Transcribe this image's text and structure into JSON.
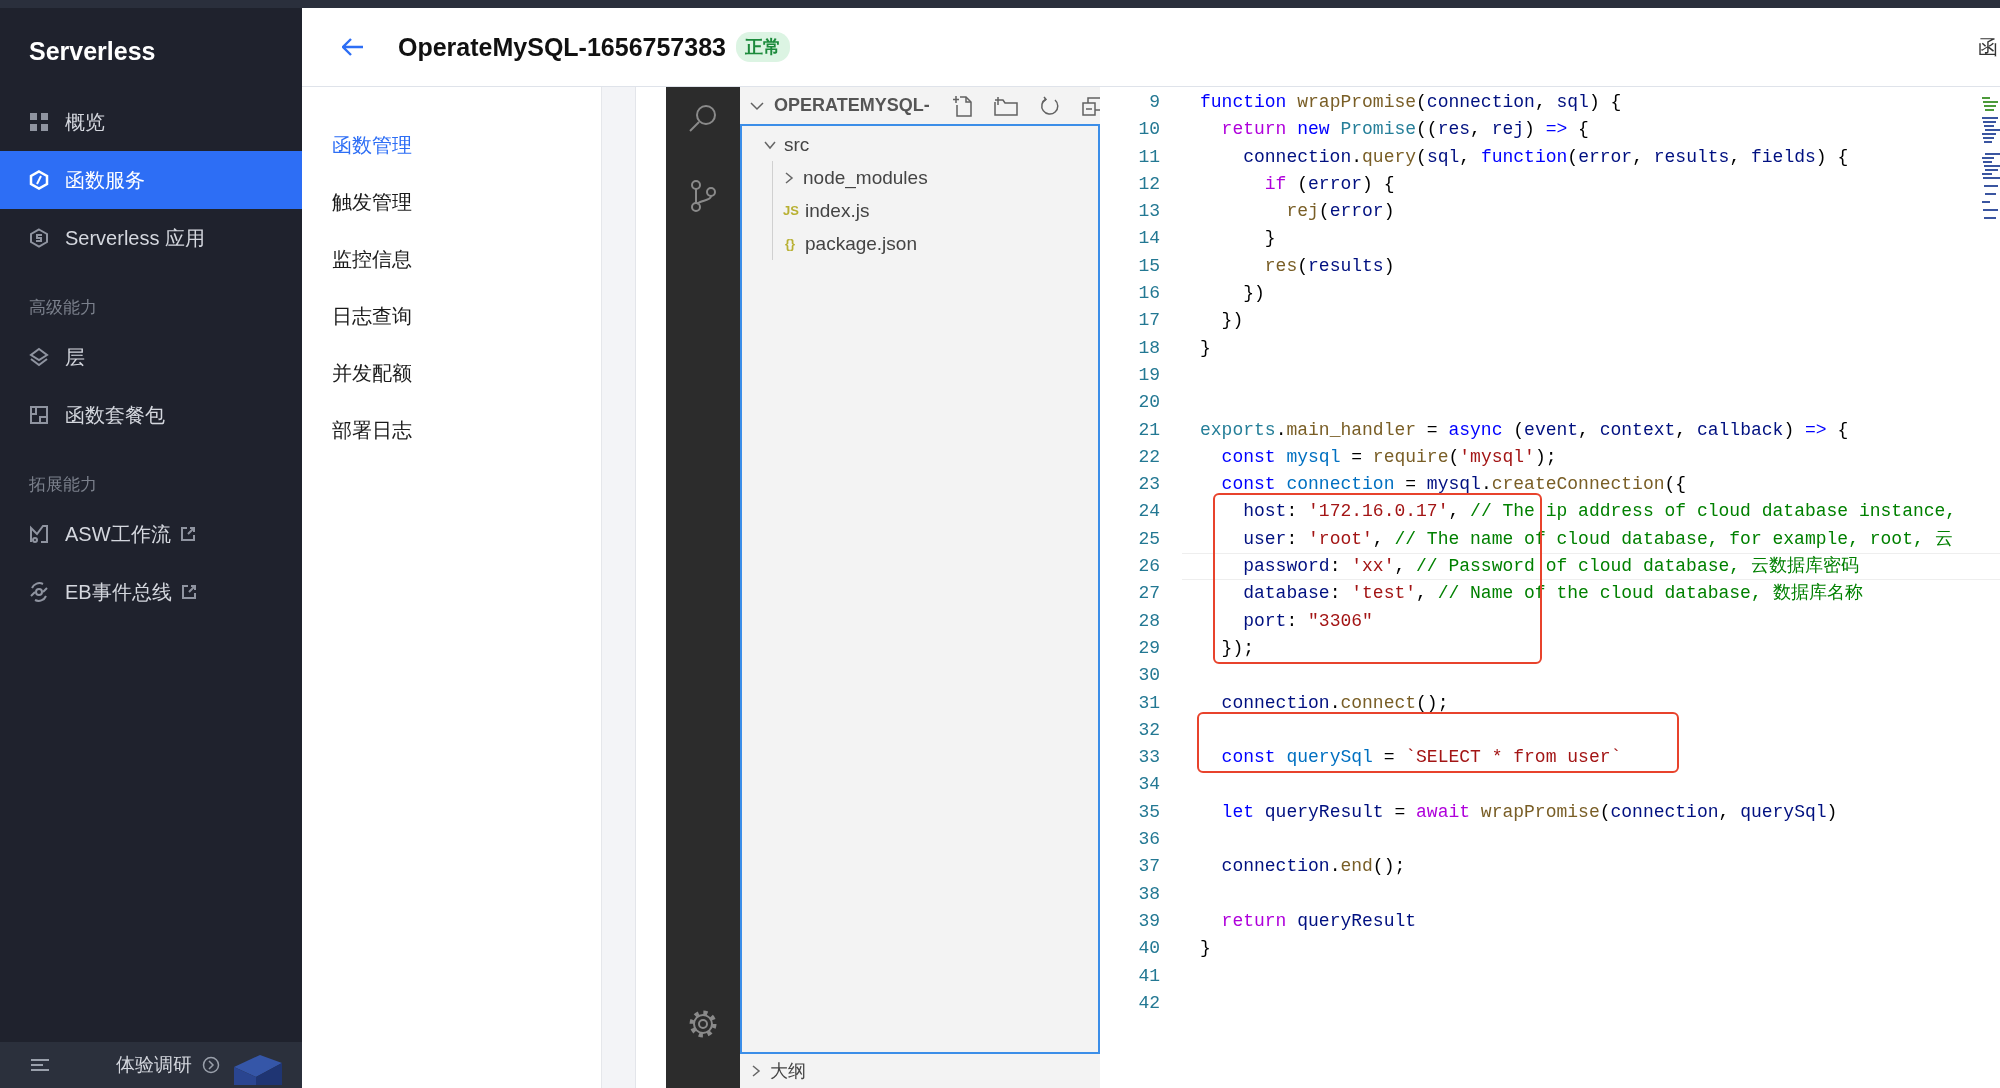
{
  "sidebar": {
    "logo": "Serverless",
    "groups": [
      {
        "items": [
          {
            "label": "概览",
            "selected": false
          },
          {
            "label": "函数服务",
            "selected": true
          },
          {
            "label": "Serverless 应用",
            "selected": false
          }
        ]
      },
      {
        "heading": "高级能力",
        "items": [
          {
            "label": "层",
            "selected": false
          },
          {
            "label": "函数套餐包",
            "selected": false
          }
        ]
      },
      {
        "heading": "拓展能力",
        "items": [
          {
            "label": "ASW工作流",
            "selected": false,
            "external": true
          },
          {
            "label": "EB事件总线",
            "selected": false,
            "external": true
          }
        ]
      }
    ],
    "survey": "体验调研"
  },
  "header": {
    "title": "OperateMySQL-1656757383",
    "status": "正常",
    "right_text": "函"
  },
  "subnav": [
    {
      "label": "函数管理",
      "selected": true
    },
    {
      "label": "触发管理",
      "selected": false
    },
    {
      "label": "监控信息",
      "selected": false
    },
    {
      "label": "日志查询",
      "selected": false
    },
    {
      "label": "并发配额",
      "selected": false
    },
    {
      "label": "部署日志",
      "selected": false
    }
  ],
  "explorer": {
    "title": "OPERATEMYSQL-",
    "tree": [
      {
        "label": "src",
        "kind": "folder",
        "expanded": true,
        "children": [
          {
            "label": "node_modules",
            "kind": "folder",
            "expanded": false
          },
          {
            "label": "index.js",
            "kind": "file",
            "icon_text": "JS"
          },
          {
            "label": "package.json",
            "kind": "file",
            "icon_text": "{}"
          }
        ]
      }
    ],
    "outline": "大纲"
  },
  "editor": {
    "lines": [
      {
        "kind": "line",
        "number": "9",
        "tokens": [
          {
            "kind": "kw",
            "text": "function"
          },
          {
            "kind": "fn",
            "text": " wrapPromise"
          },
          {
            "kind": "plain",
            "text": "("
          },
          {
            "kind": "var",
            "text": "connection"
          },
          {
            "kind": "plain",
            "text": ", "
          },
          {
            "kind": "var",
            "text": "sql"
          },
          {
            "kind": "plain",
            "text": ") {"
          }
        ]
      },
      {
        "kind": "line",
        "number": "10",
        "tokens": [
          {
            "kind": "ctrl",
            "text": "  return"
          },
          {
            "kind": "kw",
            "text": " new"
          },
          {
            "kind": "type",
            "text": " Promise"
          },
          {
            "kind": "plain",
            "text": "(("
          },
          {
            "kind": "var",
            "text": "res"
          },
          {
            "kind": "plain",
            "text": ", "
          },
          {
            "kind": "var",
            "text": "rej"
          },
          {
            "kind": "plain",
            "text": ") "
          },
          {
            "kind": "kw",
            "text": "=>"
          },
          {
            "kind": "plain",
            "text": " {"
          }
        ]
      },
      {
        "kind": "line",
        "number": "11",
        "tokens": [
          {
            "kind": "var",
            "text": "    connection"
          },
          {
            "kind": "plain",
            "text": "."
          },
          {
            "kind": "fn",
            "text": "query"
          },
          {
            "kind": "plain",
            "text": "("
          },
          {
            "kind": "var",
            "text": "sql"
          },
          {
            "kind": "plain",
            "text": ", "
          },
          {
            "kind": "kw",
            "text": "function"
          },
          {
            "kind": "plain",
            "text": "("
          },
          {
            "kind": "var",
            "text": "error"
          },
          {
            "kind": "plain",
            "text": ", "
          },
          {
            "kind": "var",
            "text": "results"
          },
          {
            "kind": "plain",
            "text": ", "
          },
          {
            "kind": "var",
            "text": "fields"
          },
          {
            "kind": "plain",
            "text": ") {"
          }
        ]
      },
      {
        "kind": "line",
        "number": "12",
        "tokens": [
          {
            "kind": "ctrl",
            "text": "      if"
          },
          {
            "kind": "plain",
            "text": " ("
          },
          {
            "kind": "var",
            "text": "error"
          },
          {
            "kind": "plain",
            "text": ") {"
          }
        ]
      },
      {
        "kind": "line",
        "number": "13",
        "tokens": [
          {
            "kind": "fn",
            "text": "        rej"
          },
          {
            "kind": "plain",
            "text": "("
          },
          {
            "kind": "var",
            "text": "error"
          },
          {
            "kind": "plain",
            "text": ")"
          }
        ]
      },
      {
        "kind": "line",
        "number": "14",
        "tokens": [
          {
            "kind": "plain",
            "text": "      }"
          }
        ]
      },
      {
        "kind": "line",
        "number": "15",
        "tokens": [
          {
            "kind": "fn",
            "text": "      res"
          },
          {
            "kind": "plain",
            "text": "("
          },
          {
            "kind": "var",
            "text": "results"
          },
          {
            "kind": "plain",
            "text": ")"
          }
        ]
      },
      {
        "kind": "line",
        "number": "16",
        "tokens": [
          {
            "kind": "plain",
            "text": "    })"
          }
        ]
      },
      {
        "kind": "line",
        "number": "17",
        "tokens": [
          {
            "kind": "plain",
            "text": "  })"
          }
        ]
      },
      {
        "kind": "line",
        "number": "18",
        "tokens": [
          {
            "kind": "plain",
            "text": "}"
          }
        ]
      },
      {
        "kind": "line",
        "number": "19"
      },
      {
        "kind": "line",
        "number": "20"
      },
      {
        "kind": "line",
        "number": "21",
        "tokens": [
          {
            "kind": "type",
            "text": "exports"
          },
          {
            "kind": "plain",
            "text": "."
          },
          {
            "kind": "fn",
            "text": "main_handler"
          },
          {
            "kind": "plain",
            "text": " = "
          },
          {
            "kind": "kw",
            "text": "async"
          },
          {
            "kind": "plain",
            "text": " ("
          },
          {
            "kind": "var",
            "text": "event"
          },
          {
            "kind": "plain",
            "text": ", "
          },
          {
            "kind": "var",
            "text": "context"
          },
          {
            "kind": "plain",
            "text": ", "
          },
          {
            "kind": "var",
            "text": "callback"
          },
          {
            "kind": "plain",
            "text": ") "
          },
          {
            "kind": "kw",
            "text": "=>"
          },
          {
            "kind": "plain",
            "text": " {"
          }
        ]
      },
      {
        "kind": "line",
        "number": "22",
        "tokens": [
          {
            "kind": "kw",
            "text": "  const"
          },
          {
            "kind": "const",
            "text": " mysql"
          },
          {
            "kind": "plain",
            "text": " = "
          },
          {
            "kind": "fn",
            "text": "require"
          },
          {
            "kind": "plain",
            "text": "("
          },
          {
            "kind": "str",
            "text": "'mysql'"
          },
          {
            "kind": "plain",
            "text": ");"
          }
        ]
      },
      {
        "kind": "line",
        "number": "23",
        "tokens": [
          {
            "kind": "kw",
            "text": "  const"
          },
          {
            "kind": "const",
            "text": " connection"
          },
          {
            "kind": "plain",
            "text": " = "
          },
          {
            "kind": "var",
            "text": "mysql"
          },
          {
            "kind": "plain",
            "text": "."
          },
          {
            "kind": "fn",
            "text": "createConnection"
          },
          {
            "kind": "plain",
            "text": "({"
          }
        ]
      },
      {
        "kind": "frame",
        "lines": [
          {
            "kind": "line",
            "number": "24",
            "tokens": [
              {
                "kind": "var",
                "text": "    host"
              },
              {
                "kind": "plain",
                "text": ": "
              },
              {
                "kind": "str",
                "text": "'172.16.0.17'"
              },
              {
                "kind": "plain",
                "text": ", "
              },
              {
                "kind": "comment",
                "text": "// The ip address of cloud database instance,"
              }
            ]
          },
          {
            "kind": "line",
            "number": "25",
            "tokens": [
              {
                "kind": "var",
                "text": "    user"
              },
              {
                "kind": "plain",
                "text": ": "
              },
              {
                "kind": "str",
                "text": "'root'"
              },
              {
                "kind": "plain",
                "text": ", "
              },
              {
                "kind": "comment",
                "text": "// The name of cloud database, for example, root, 云"
              }
            ]
          },
          {
            "kind": "line",
            "number": "26",
            "current": true,
            "tokens": [
              {
                "kind": "var",
                "text": "    password"
              },
              {
                "kind": "plain",
                "text": ": "
              },
              {
                "kind": "str",
                "text": "'xx'"
              },
              {
                "kind": "plain",
                "text": ", "
              },
              {
                "kind": "comment",
                "text": "// Password of cloud database, 云数据库密码"
              }
            ]
          },
          {
            "kind": "line",
            "number": "27",
            "tokens": [
              {
                "kind": "var",
                "text": "    database"
              },
              {
                "kind": "plain",
                "text": ": "
              },
              {
                "kind": "str",
                "text": "'test'"
              },
              {
                "kind": "plain",
                "text": ", "
              },
              {
                "kind": "comment",
                "text": "// Name of the cloud database, 数据库名称"
              }
            ]
          },
          {
            "kind": "line",
            "number": "28",
            "tokens": [
              {
                "kind": "var",
                "text": "    port"
              },
              {
                "kind": "plain",
                "text": ": "
              },
              {
                "kind": "str",
                "text": "\"3306\""
              }
            ]
          },
          {
            "kind": "line",
            "number": "29",
            "tokens": [
              {
                "kind": "plain",
                "text": "  });"
              }
            ]
          }
        ]
      },
      {
        "kind": "line",
        "number": "30"
      },
      {
        "kind": "line",
        "number": "31",
        "tokens": [
          {
            "kind": "var",
            "text": "  connection"
          },
          {
            "kind": "plain",
            "text": "."
          },
          {
            "kind": "fn",
            "text": "connect"
          },
          {
            "kind": "plain",
            "text": "();"
          }
        ]
      },
      {
        "kind": "frame",
        "lines": [
          {
            "kind": "line",
            "number": "32"
          },
          {
            "kind": "line",
            "number": "33",
            "tokens": [
              {
                "kind": "kw",
                "text": "  const"
              },
              {
                "kind": "const",
                "text": " querySql"
              },
              {
                "kind": "plain",
                "text": " = "
              },
              {
                "kind": "str",
                "text": "`SELECT * from user`"
              }
            ]
          }
        ]
      },
      {
        "kind": "line",
        "number": "34"
      },
      {
        "kind": "line",
        "number": "35",
        "tokens": [
          {
            "kind": "kw",
            "text": "  let"
          },
          {
            "kind": "var",
            "text": " queryResult"
          },
          {
            "kind": "plain",
            "text": " = "
          },
          {
            "kind": "ctrl",
            "text": "await"
          },
          {
            "kind": "fn",
            "text": " wrapPromise"
          },
          {
            "kind": "plain",
            "text": "("
          },
          {
            "kind": "var",
            "text": "connection"
          },
          {
            "kind": "plain",
            "text": ", "
          },
          {
            "kind": "var",
            "text": "querySql"
          },
          {
            "kind": "plain",
            "text": ")"
          }
        ]
      },
      {
        "kind": "line",
        "number": "36"
      },
      {
        "kind": "line",
        "number": "37",
        "tokens": [
          {
            "kind": "var",
            "text": "  connection"
          },
          {
            "kind": "plain",
            "text": "."
          },
          {
            "kind": "fn",
            "text": "end"
          },
          {
            "kind": "plain",
            "text": "();"
          }
        ]
      },
      {
        "kind": "line",
        "number": "38"
      },
      {
        "kind": "line",
        "number": "39",
        "tokens": [
          {
            "kind": "ctrl",
            "text": "  return"
          },
          {
            "kind": "var",
            "text": " queryResult"
          }
        ]
      },
      {
        "kind": "line",
        "number": "40",
        "tokens": [
          {
            "kind": "plain",
            "text": "}"
          }
        ]
      },
      {
        "kind": "line",
        "number": "41"
      },
      {
        "kind": "line",
        "number": "42"
      }
    ]
  }
}
